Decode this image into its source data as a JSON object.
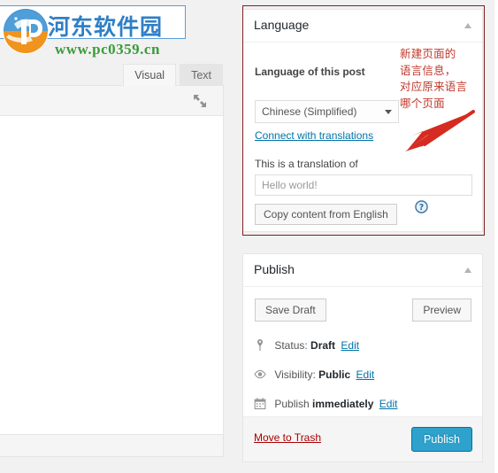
{
  "watermark": {
    "site_name_cn": "河东软件园",
    "url": "www.pc0359.cn",
    "logo_icon": "shield-logo-icon",
    "brand_blue": "#2f7fc6",
    "brand_green": "#3a9c3a"
  },
  "editor": {
    "tabs": [
      {
        "label": "Visual",
        "active": true
      },
      {
        "label": "Text",
        "active": false
      }
    ],
    "fullscreen_icon": "fullscreen-expand-icon"
  },
  "language_panel": {
    "title": "Language",
    "toggle_icon": "chevron-up-icon",
    "field_label": "Language of this post",
    "select_value": "Chinese (Simplified)",
    "select_caret_icon": "chevron-down-icon",
    "connect_link": "Connect with translations",
    "translation_of_label": "This is a translation of",
    "translation_input_placeholder": "Hello world!",
    "translation_input_value": "",
    "copy_button": "Copy content from English",
    "help_icon": "help-question-icon",
    "highlight_border_color": "#7e2020"
  },
  "annotation": {
    "text": "新建页面的语言信息，对应原来语言哪个页面",
    "lines": [
      "新建页面的",
      "语言信息，",
      "对应原来语言",
      "哪个页面"
    ],
    "color": "#c0392b",
    "arrow_icon": "red-arrow-pointer"
  },
  "publish_panel": {
    "title": "Publish",
    "toggle_icon": "chevron-up-icon",
    "save_draft_button": "Save Draft",
    "preview_button": "Preview",
    "rows": [
      {
        "icon": "pin-icon",
        "prefix": "Status:",
        "value": "Draft",
        "edit_label": "Edit"
      },
      {
        "icon": "eye-icon",
        "prefix": "Visibility:",
        "value": "Public",
        "edit_label": "Edit"
      },
      {
        "icon": "calendar-icon",
        "prefix": "Publish",
        "value": "immediately",
        "edit_label": "Edit"
      }
    ],
    "trash_link": "Move to Trash",
    "publish_button": "Publish",
    "publish_button_color": "#2ea2cc",
    "trash_link_color": "#a00"
  }
}
